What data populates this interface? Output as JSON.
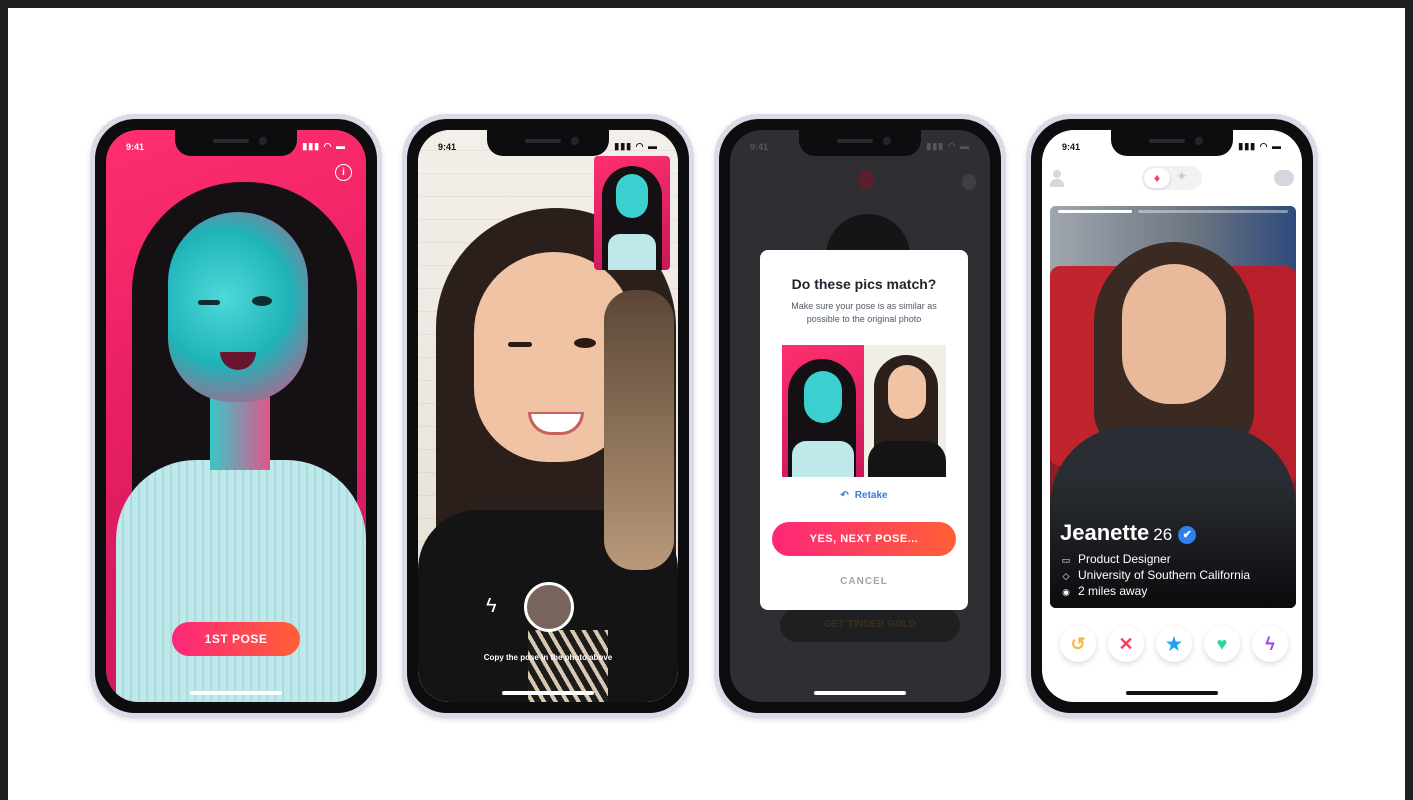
{
  "status": {
    "time": "9:41",
    "icons": "▮▮▮ ◠ ▬"
  },
  "screen1": {
    "button_label": "1ST POSE",
    "info_glyph": "i"
  },
  "screen2": {
    "hint": "Copy the pose in the photo above",
    "flash_glyph": "ϟ"
  },
  "screen3": {
    "modal_title": "Do these pics match?",
    "modal_subtitle": "Make sure your pose is as similar as possible to the original photo",
    "retake_label": "Retake",
    "retake_glyph": "↶",
    "yes_label": "YES, NEXT POSE...",
    "cancel_label": "CANCEL",
    "background_button": "GET TINDER GOLD"
  },
  "screen4": {
    "name": "Jeanette",
    "age": "26",
    "verified_glyph": "✔",
    "job": "Product Designer",
    "school": "University of Southern California",
    "distance": "2 miles away",
    "job_glyph": "▭",
    "school_glyph": "◇",
    "distance_glyph": "◉",
    "flame_glyph": "♦",
    "sparkle_glyph": "✦",
    "actions": [
      {
        "name": "rewind-icon",
        "glyph": "↺",
        "color": "#f5b748"
      },
      {
        "name": "nope-icon",
        "glyph": "✕",
        "color": "#fd3a5c"
      },
      {
        "name": "super-like-icon",
        "glyph": "★",
        "color": "#1fa2f2"
      },
      {
        "name": "like-icon",
        "glyph": "♥",
        "color": "#2dd4a5"
      },
      {
        "name": "boost-icon",
        "glyph": "ϟ",
        "color": "#9c48ee"
      }
    ]
  },
  "colors": {
    "brand_start": "#fd267a",
    "brand_end": "#ff6036",
    "verified": "#2f80ed",
    "retake": "#3a7bd5"
  }
}
